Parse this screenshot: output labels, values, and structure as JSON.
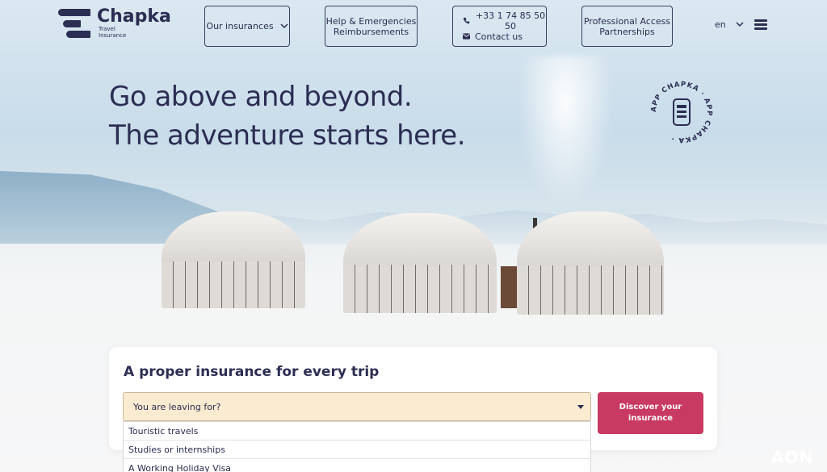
{
  "brand": {
    "name": "Chapka",
    "sub_line1": "Travel",
    "sub_line2": "Insurance"
  },
  "nav": {
    "insurances": "Our insurances",
    "help_line1": "Help & Emergencies",
    "help_line2": "Reimbursements",
    "phone": "+33 1 74 85 50 50",
    "contact": "Contact us",
    "pro_line1": "Professional Access",
    "pro_line2": "Partnerships",
    "lang": "en"
  },
  "hero": {
    "line1": "Go above and beyond.",
    "line2": "The adventure starts here.",
    "badge_text": "APP CHAPKA · APP CHAPKA ·"
  },
  "form": {
    "title": "A proper insurance for every trip",
    "select_value": "You are leaving for?",
    "options": [
      "Touristic travels",
      "Studies or internships",
      "A Working Holiday Visa"
    ],
    "cta": "Discover your insurance"
  },
  "footer_brand": "AON",
  "colors": {
    "primary": "#2b2d52",
    "accent": "#c83a62",
    "select_bg": "#fbebd0"
  }
}
